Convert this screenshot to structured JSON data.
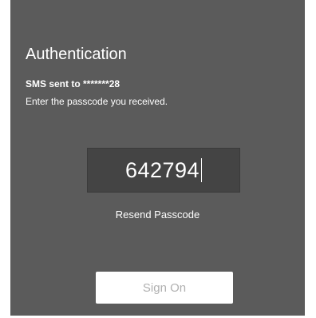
{
  "auth": {
    "title": "Authentication",
    "sms_status": "SMS sent to *******28",
    "instruction": "Enter the passcode you received."
  },
  "passcode": {
    "value": "642794"
  },
  "actions": {
    "resend_label": "Resend Passcode",
    "signon_label": "Sign On"
  },
  "colors": {
    "panel": "#5b5b5b",
    "input_bg": "#444444",
    "button_bg": "#ffffff",
    "button_text": "#b0b0b0"
  }
}
